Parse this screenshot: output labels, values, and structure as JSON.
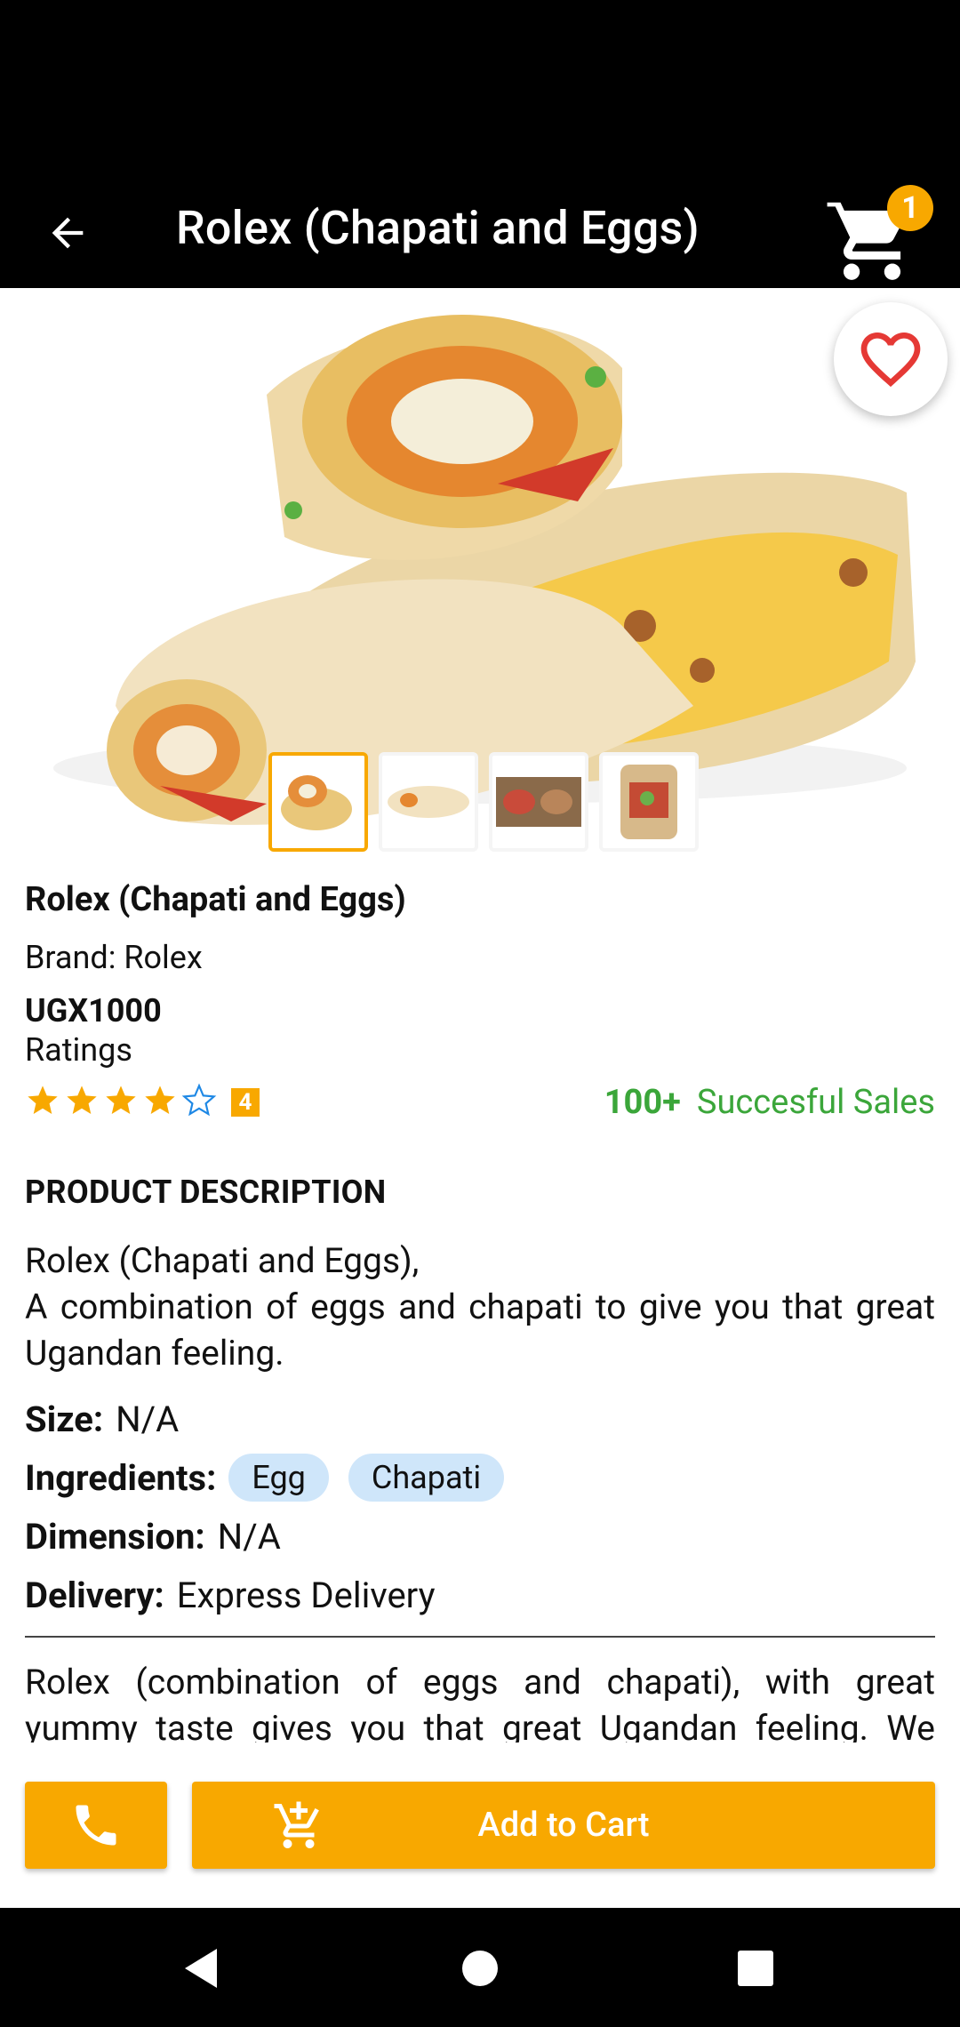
{
  "header": {
    "title": "Rolex (Chapati and Eggs)",
    "cart_count": "1"
  },
  "product": {
    "name": "Rolex (Chapati and Eggs)",
    "brand": "Brand: Rolex",
    "price": "UGX1000",
    "ratings_label": "Ratings",
    "rating_value": "4",
    "rating_stars_filled": 4,
    "rating_stars_total": 5,
    "sales_count": "100+",
    "sales_label": "Succesful Sales"
  },
  "description": {
    "heading": "PRODUCT DESCRIPTION",
    "line1": "Rolex (Chapati and Eggs),",
    "line2": "A combination of eggs and chapati to give you that great Ugandan feeling."
  },
  "specs": {
    "size_key": "Size:",
    "size_val": "N/A",
    "ingredients_key": "Ingredients:",
    "ingredients": [
      "Egg",
      "Chapati"
    ],
    "dimension_key": "Dimension:",
    "dimension_val": "N/A",
    "delivery_key": "Delivery:",
    "delivery_val": "Express Delivery"
  },
  "long_description": "Rolex (combination of eggs and chapati), with great yummy taste gives you that great Ugandan feeling. We carry a well-sold famous food at great prices (No",
  "actions": {
    "add_to_cart": "Add to Cart"
  },
  "colors": {
    "accent": "#F8A800",
    "sales_green": "#3BA63A",
    "chip_bg": "#CFE6FA"
  }
}
